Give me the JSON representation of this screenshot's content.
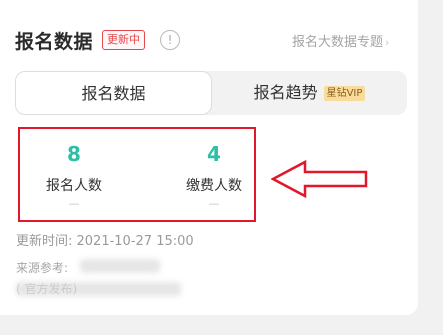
{
  "header": {
    "title": "报名数据",
    "badge": "更新中",
    "info_icon": "!",
    "link_label": "报名大数据专题",
    "link_chevron": "›"
  },
  "tabs": [
    {
      "label": "报名数据",
      "active": true
    },
    {
      "label": "报名趋势",
      "active": false,
      "badge": "星钻VIP"
    }
  ],
  "stats": [
    {
      "value": "8",
      "label": "报名人数",
      "sub": "—"
    },
    {
      "value": "4",
      "label": "缴费人数",
      "sub": "—"
    }
  ],
  "updated": "更新时间: 2021-10-27 15:00",
  "source": {
    "label": "来源参考:",
    "faint": "(      官方发布)"
  },
  "colors": {
    "accent_teal": "#2ebfa5",
    "badge_red": "#e5484d",
    "highlight_red": "#e1172b",
    "vip_gold": "#f9dc9c"
  },
  "icons": {
    "info": "info-circle-icon",
    "chevron": "chevron-right-icon",
    "arrow": "left-arrow-icon"
  }
}
